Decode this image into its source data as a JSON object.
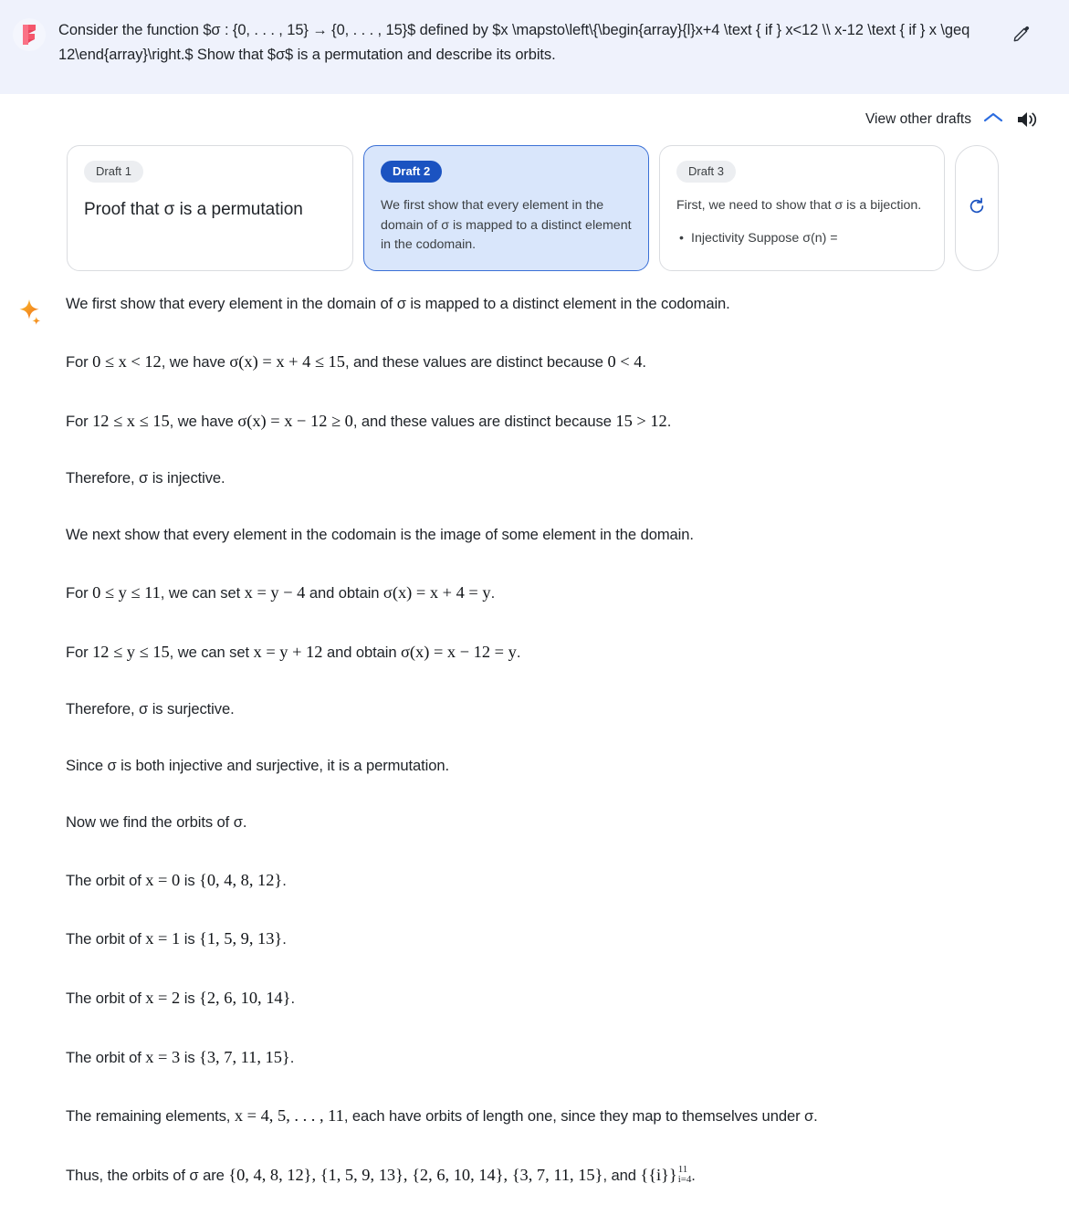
{
  "prompt": {
    "avatar_icon": "flag-logo-icon",
    "text": "Consider the function $σ : {0, . . . , 15} → {0, . . . , 15}$ defined by $x \\mapsto\\left\\{\\begin{array}{l}x+4 \\text { if } x<12 \\\\ x-12 \\text { if } x \\geq 12\\end{array}\\right.$ Show that $σ$ is a permutation and describe its orbits.",
    "edit_icon": "pencil-icon"
  },
  "drafts_header": {
    "view_label": "View other drafts",
    "chevron_icon": "chevron-up-icon",
    "speaker_icon": "speaker-volume-icon",
    "accent_color": "#1a73e8"
  },
  "drafts": [
    {
      "badge": "Draft 1",
      "body": "Proof that σ is a permutation",
      "selected": false,
      "clipped": ""
    },
    {
      "badge": "Draft 2",
      "body": "We first show that every element in the domain of σ is mapped to a distinct element in the codomain.",
      "selected": true,
      "clipped": ""
    },
    {
      "badge": "Draft 3",
      "body": "First, we need to show that σ is a bijection.",
      "selected": false,
      "clipped": "Injectivity Suppose σ(n) ="
    }
  ],
  "regenerate": {
    "icon": "refresh-icon",
    "color": "#1b53c1"
  },
  "response": {
    "sparkle_icon": "sparkle-icon",
    "p1": "We first show that every element in the domain of σ is mapped to a distinct element in the codomain.",
    "p2_prefix": "For ",
    "p2_mid": ", we have ",
    "p2_mid2": ", and these values are distinct because ",
    "p2_end": ".",
    "p2_math1": "0 ≤ x < 12",
    "p2_math2": "σ(x) = x + 4 ≤ 15",
    "p2_math3": "0 < 4",
    "p3_math1": "12 ≤ x ≤ 15",
    "p3_math2": "σ(x) = x − 12 ≥ 0",
    "p3_math3": "15 > 12",
    "p4": "Therefore, σ is injective.",
    "p5": "We next show that every element in the codomain is the image of some element in the domain.",
    "p6_math1": "0 ≤ y ≤ 11",
    "p6_mid": ", we can set ",
    "p6_math2": "x = y − 4",
    "p6_mid2": " and obtain ",
    "p6_math3": "σ(x) = x + 4 = y",
    "p7_math1": "12 ≤ y ≤ 15",
    "p7_math2": "x = y + 12",
    "p7_math3": "σ(x) = x − 12 = y",
    "p8": "Therefore, σ is surjective.",
    "p9": "Since σ is both injective and surjective, it is a permutation.",
    "p10": "Now we find the orbits of σ.",
    "orbit_prefix": "The orbit of ",
    "orbit_is": " is ",
    "orbits": [
      {
        "x": "x = 0",
        "set": "{0, 4, 8, 12}"
      },
      {
        "x": "x = 1",
        "set": "{1, 5, 9, 13}"
      },
      {
        "x": "x = 2",
        "set": "{2, 6, 10, 14}"
      },
      {
        "x": "x = 3",
        "set": "{3, 7, 11, 15}"
      }
    ],
    "p15_a": "The remaining elements, ",
    "p15_math": "x = 4, 5, . . . , 11",
    "p15_b": ", each have orbits of length one, since they map to themselves under σ.",
    "p16_a": "Thus, the orbits of σ are ",
    "p16_sets": "{0, 4, 8, 12}, {1, 5, 9, 13}, {2, 6, 10, 14}, {3, 7, 11, 15}",
    "p16_b": ", and ",
    "p16_last_base": "{{i}}",
    "p16_last_sup": "11",
    "p16_last_sub": "i=4",
    "p16_end": "."
  }
}
